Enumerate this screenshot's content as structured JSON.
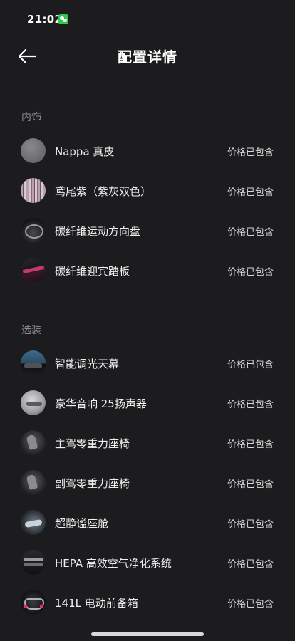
{
  "status_bar": {
    "time": "21:02",
    "notification_icon": "wechat-icon"
  },
  "header": {
    "title": "配置详情",
    "back_icon": "arrow-left-icon"
  },
  "sections": [
    {
      "label": "内饰",
      "items": [
        {
          "name": "Nappa 真皮",
          "price": "价格已包含",
          "thumb": "leather-swatch"
        },
        {
          "name": "鸢尾紫（紫灰双色）",
          "price": "价格已包含",
          "thumb": "color-swatch"
        },
        {
          "name": "碳纤维运动方向盘",
          "price": "价格已包含",
          "thumb": "steering-wheel"
        },
        {
          "name": "碳纤维迎宾踏板",
          "price": "价格已包含",
          "thumb": "door-sill"
        }
      ]
    },
    {
      "label": "选装",
      "items": [
        {
          "name": "智能调光天幕",
          "price": "价格已包含",
          "thumb": "sunroof"
        },
        {
          "name": "豪华音响 25扬声器",
          "price": "价格已包含",
          "thumb": "speaker"
        },
        {
          "name": "主驾零重力座椅",
          "price": "价格已包含",
          "thumb": "seat"
        },
        {
          "name": "副驾零重力座椅",
          "price": "价格已包含",
          "thumb": "seat"
        },
        {
          "name": "超静谧座舱",
          "price": "价格已包含",
          "thumb": "cabin"
        },
        {
          "name": "HEPA 高效空气净化系统",
          "price": "价格已包含",
          "thumb": "air-filter"
        },
        {
          "name": "141L 电动前备箱",
          "price": "价格已包含",
          "thumb": "front-trunk"
        }
      ]
    }
  ]
}
